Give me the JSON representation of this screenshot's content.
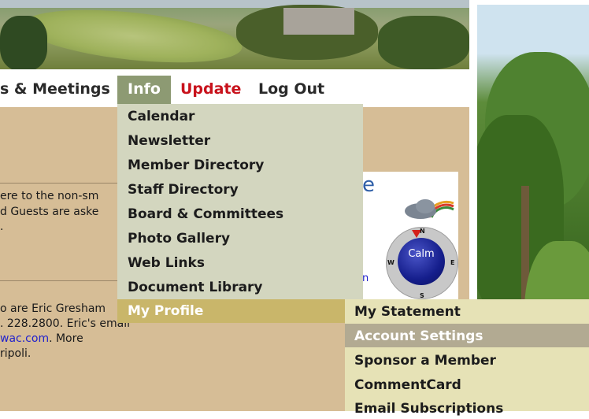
{
  "nav": {
    "meetings_label": "s & Meetings",
    "info_label": "Info",
    "update_label": "Update",
    "logout_label": "Log Out"
  },
  "info_menu": {
    "items": [
      "Calendar",
      "Newsletter",
      "Member Directory",
      "Staff Directory",
      "Board & Committees",
      "Photo Gallery",
      "Web Links",
      "Document Library"
    ],
    "my_profile_label": "My Profile"
  },
  "profile_submenu": {
    "items": [
      "My Statement",
      "Account Settings",
      "Sponsor a Member",
      "CommentCard",
      "Email Subscriptions"
    ]
  },
  "content": {
    "line1": "ere to the non-sm",
    "line2": "d Guests are aske",
    "line3": ".",
    "line4": "o are Eric Gresham",
    "line5": ". 228.2800. Eric's email",
    "line6_link": "wac.com",
    "line6_rest": ". More",
    "line7": "ripoli."
  },
  "weather": {
    "heading_fragment": "e",
    "wind_status": "Calm",
    "compass": {
      "n": "N",
      "s": "S",
      "e": "E",
      "w": "W"
    },
    "link_fragment": "n"
  },
  "colors": {
    "update_red": "#c8121c",
    "info_active": "#8d9a73",
    "menu_bg": "#d3d6bf",
    "profile_highlight": "#c9b66a",
    "submenu_bg": "#e6e2b6",
    "submenu_highlight": "#b2aa92",
    "content_bg": "#d6bd96"
  }
}
